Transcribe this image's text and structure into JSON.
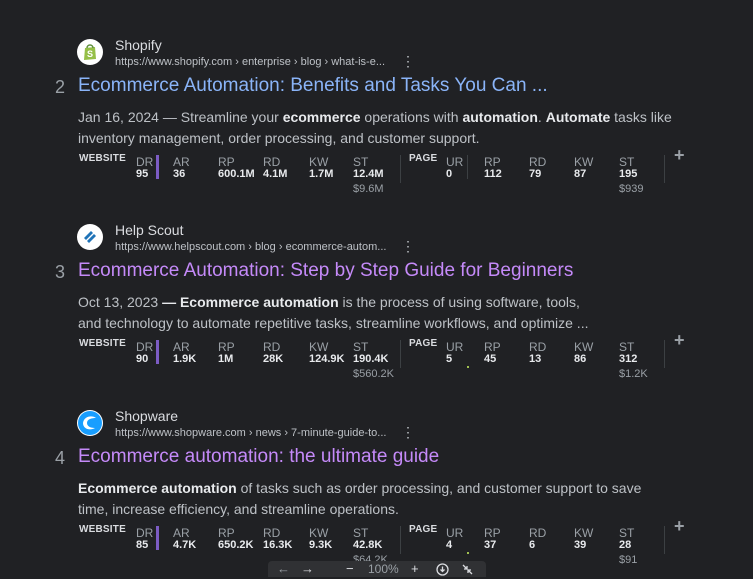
{
  "results": [
    {
      "rank": "2",
      "site_name": "Shopify",
      "url": "https://www.shopify.com › enterprise › blog › what-is-e...",
      "title": "Ecommerce Automation: Benefits and Tasks You Can ...",
      "title_color": "#8ab4f8",
      "snippet_date": "Jan 16, 2024",
      "snippet_parts": [
        "— Streamline your ",
        "ecommerce",
        " operations with ",
        "automation",
        ". ",
        "Automate",
        " tasks like inventory management, order processing, and customer support."
      ],
      "favicon": "shopify-bag-icon",
      "metrics": {
        "website_label": "WEBSITE",
        "dr": "95",
        "ar": "36",
        "rp": "600.1M",
        "rd": "4.1M",
        "kw": "1.7M",
        "st": "12.4M",
        "st_sub": "$9.6M",
        "page_label": "PAGE",
        "ur": "0",
        "p_rp": "112",
        "p_rd": "79",
        "p_kw": "87",
        "p_st": "195",
        "p_st_sub": "$939"
      }
    },
    {
      "rank": "3",
      "site_name": "Help Scout",
      "url": "https://www.helpscout.com › blog › ecommerce-autom...",
      "title": "Ecommerce Automation: Step by Step Guide for Beginners",
      "title_color": "#c58af9",
      "snippet_date": "Oct 13, 2023",
      "snippet_parts": [
        "— ",
        "Ecommerce automation",
        " is the process of using software, tools, and technology to automate repetitive tasks, streamline workflows, and optimize ..."
      ],
      "favicon": "helpscout-icon",
      "metrics": {
        "website_label": "WEBSITE",
        "dr": "90",
        "ar": "1.9K",
        "rp": "1M",
        "rd": "28K",
        "kw": "124.9K",
        "st": "190.4K",
        "st_sub": "$560.2K",
        "page_label": "PAGE",
        "ur": "5",
        "p_rp": "45",
        "p_rd": "13",
        "p_kw": "86",
        "p_st": "312",
        "p_st_sub": "$1.2K"
      }
    },
    {
      "rank": "4",
      "site_name": "Shopware",
      "url": "https://www.shopware.com › news › 7-minute-guide-to...",
      "title": "Ecommerce automation: the ultimate guide",
      "title_color": "#c58af9",
      "snippet_date": "",
      "snippet_parts": [
        "",
        "Ecommerce automation",
        " of tasks such as order processing, and customer support to save time, increase efficiency, and streamline operations."
      ],
      "favicon": "shopware-icon",
      "metrics": {
        "website_label": "WEBSITE",
        "dr": "85",
        "ar": "4.7K",
        "rp": "650.2K",
        "rd": "16.3K",
        "kw": "9.3K",
        "st": "42.8K",
        "st_sub": "$64.2K",
        "page_label": "PAGE",
        "ur": "4",
        "p_rp": "37",
        "p_rd": "6",
        "p_kw": "39",
        "p_st": "28",
        "p_st_sub": "$91"
      }
    }
  ],
  "metric_labels": {
    "dr": "DR",
    "ar": "AR",
    "rp": "RP",
    "rd": "RD",
    "kw": "KW",
    "st": "ST",
    "ur": "UR",
    "p_rp": "RP",
    "p_rd": "RD",
    "p_kw": "KW",
    "p_st": "ST"
  },
  "plus_symbol": "+",
  "kebab_symbol": "⋮",
  "bottom_bar": {
    "back": "←",
    "forward": "→",
    "zoom_out": "−",
    "zoom_level": "100%",
    "zoom_in": "+"
  },
  "colors": {
    "background": "#202124",
    "visited_link": "#c58af9",
    "link": "#8ab4f8",
    "metric_bar": "#7c5cc4"
  }
}
